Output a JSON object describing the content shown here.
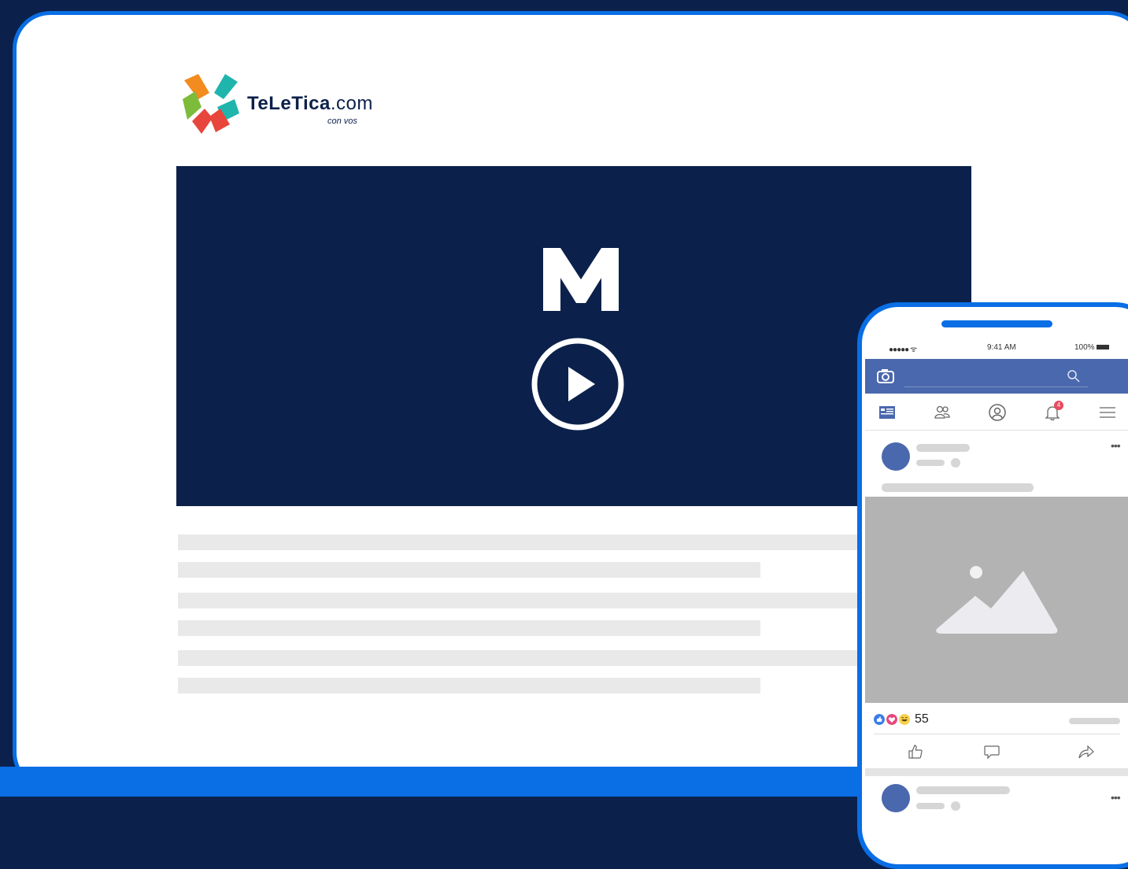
{
  "site": {
    "logo_brand": "TeLeTica",
    "logo_domain": ".com",
    "logo_tagline": "con vos"
  },
  "video": {
    "channel_mark_icon": "m-logo-icon",
    "play_icon": "play-icon"
  },
  "phone": {
    "status_dots": "●●●●● ",
    "status_wifi": "ᯤ",
    "time": "9:41 AM",
    "battery": "100%",
    "notification_count": "4",
    "reaction_count": "55",
    "icons": {
      "camera": "camera-icon",
      "search": "search-icon",
      "news_feed": "news-feed-icon",
      "friends": "friends-icon",
      "profile": "profile-icon",
      "notifications": "bell-icon",
      "menu": "menu-icon",
      "like": "like-icon",
      "comment": "comment-icon",
      "share": "share-icon"
    }
  },
  "colors": {
    "background": "#0b214b",
    "accent": "#0a6ee5",
    "facebook_blue": "#4a68ad",
    "placeholder": "#e9e9e9"
  }
}
